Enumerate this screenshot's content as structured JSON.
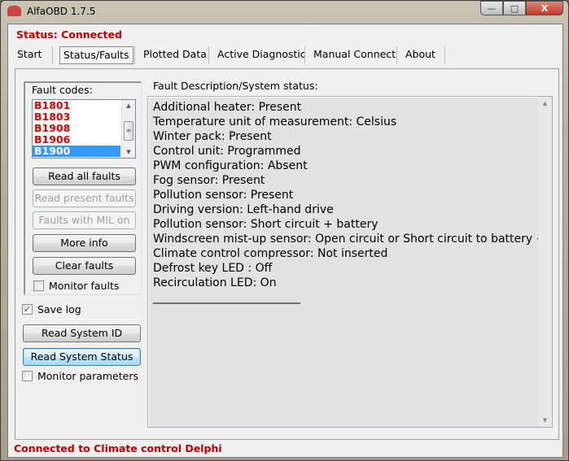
{
  "window": {
    "title": "AlfaOBD 1.7.5",
    "controls": {
      "minimize": "—",
      "maximize": "□",
      "close": "X"
    }
  },
  "status": "Status: Connected",
  "tabs": [
    {
      "label": "Start"
    },
    {
      "label": "Status/Faults",
      "selected": true
    },
    {
      "label": "Plotted Data"
    },
    {
      "label": "Active Diagnostic"
    },
    {
      "label": "Manual Connect"
    },
    {
      "label": "About"
    }
  ],
  "faults": {
    "group_label": "Fault codes:",
    "codes": [
      "B1801",
      "B1803",
      "B1908",
      "B1906",
      "B1900"
    ],
    "selected": "B1900",
    "buttons": {
      "read_all": "Read all faults",
      "read_present": "Read present faults",
      "mil_on": "Faults with MIL on",
      "more_info": "More info",
      "clear": "Clear faults"
    },
    "monitor_faults": {
      "label": "Monitor faults",
      "checked": false
    }
  },
  "save_log": {
    "label": "Save log",
    "checked": true
  },
  "read_system_id": "Read System ID",
  "read_system_status": "Read System Status",
  "monitor_parameters": {
    "label": "Monitor parameters",
    "checked": false
  },
  "description": {
    "label": "Fault Description/System status:",
    "lines": [
      "Additional heater: Present",
      "Temperature unit of measurement: Celsius",
      "Winter pack: Present",
      "Control unit: Programmed",
      "PWM configuration: Absent",
      "Fog sensor: Present",
      "Pollution sensor: Present",
      "Driving version: Left-hand drive",
      "Pollution sensor: Short circuit + battery",
      "Windscreen mist-up sensor: Open circuit or Short circuit to battery +",
      "Climate control compressor: Not inserted",
      "Defrost key LED : Off",
      "Recirculation LED: On"
    ],
    "separator": "______________________________"
  },
  "footer": "Connected to Climate control Delphi",
  "colors": {
    "status_red": "#c00000",
    "fault_red": "#e00000",
    "selection": "#3399ff"
  }
}
